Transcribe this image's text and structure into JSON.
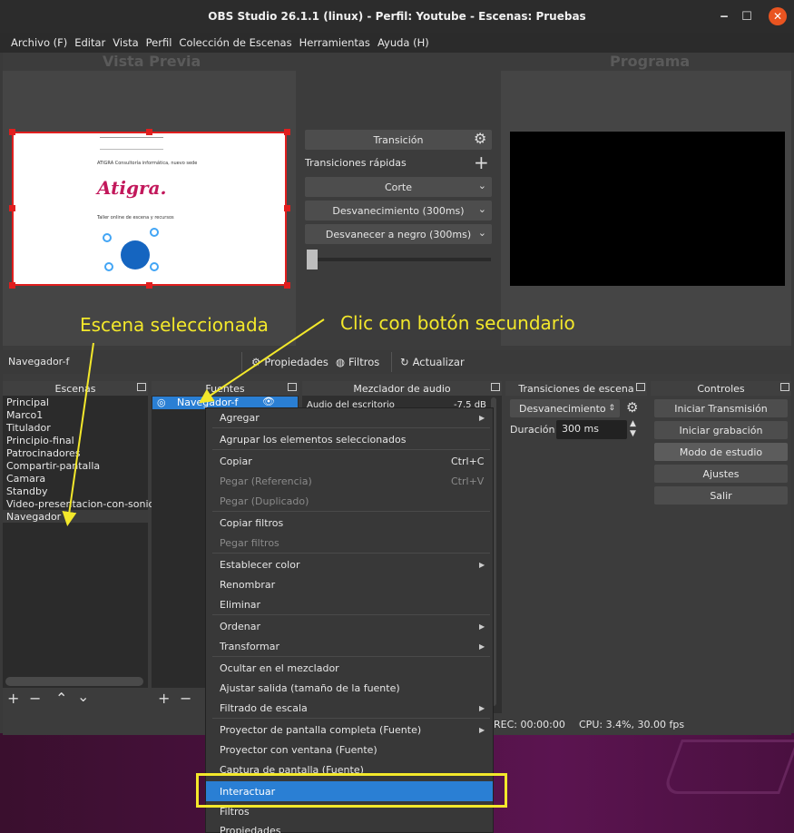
{
  "window": {
    "title": "OBS Studio 26.1.1 (linux) - Perfil: Youtube - Escenas: Pruebas",
    "minimize": "‒",
    "maximize": "☐",
    "close": "✕"
  },
  "menu": [
    "Archivo (F)",
    "Editar",
    "Vista",
    "Perfil",
    "Colección de Escenas",
    "Herramientas",
    "Ayuda (H)"
  ],
  "preview": {
    "title": "Vista Previa",
    "doc_lines": [
      "ATIGRA Consultoría informática, nuevo sede",
      "Atigra.",
      "Taller online de escena y recursos"
    ]
  },
  "program": {
    "title": "Programa"
  },
  "transition": {
    "button": "Transición",
    "quick_label": "Transiciones rápidas",
    "items": [
      "Corte",
      "Desvanecimiento (300ms)",
      "Desvanecer a negro (300ms)"
    ]
  },
  "source_bar": {
    "selected": "Navegador-f",
    "properties": "Propiedades",
    "filters": "Filtros",
    "refresh": "Actualizar"
  },
  "docks": {
    "scenes": "Escenas",
    "sources": "Fuentes",
    "mixer": "Mezclador de audio",
    "transitions": "Transiciones de escena",
    "controls": "Controles"
  },
  "scenes": [
    "Principal",
    "Marco1",
    "Titulador",
    "Principio-final",
    "Patrocinadores",
    "Compartir-pantalla",
    "Camara",
    "Standby",
    "Video-presentacion-con-sonido",
    "Navegador"
  ],
  "sources": [
    "Navegador-f"
  ],
  "mixer": {
    "channel": "Audio del escritorio",
    "level": "-7.5 dB"
  },
  "scene_transitions": {
    "selected": "Desvanecimiento",
    "duration_label": "Duración",
    "duration": "300 ms"
  },
  "controls": [
    "Iniciar Transmisión",
    "Iniciar grabación",
    "Modo de estudio",
    "Ajustes",
    "Salir"
  ],
  "status": {
    "rec": "REC: 00:00:00",
    "cpu": "CPU: 3.4%, 30.00 fps"
  },
  "context_menu": {
    "items": [
      {
        "label": "Agregar",
        "shortcut": "",
        "disabled": false,
        "submenu": true
      },
      {
        "label": "Agrupar los elementos seleccionados",
        "shortcut": "",
        "disabled": false,
        "submenu": false
      },
      {
        "label": "Copiar",
        "shortcut": "Ctrl+C",
        "disabled": false,
        "submenu": false
      },
      {
        "label": "Pegar (Referencia)",
        "shortcut": "Ctrl+V",
        "disabled": true,
        "submenu": false
      },
      {
        "label": "Pegar (Duplicado)",
        "shortcut": "",
        "disabled": true,
        "submenu": false
      },
      {
        "label": "Copiar filtros",
        "shortcut": "",
        "disabled": false,
        "submenu": false
      },
      {
        "label": "Pegar filtros",
        "shortcut": "",
        "disabled": true,
        "submenu": false
      },
      {
        "label": "Establecer color",
        "shortcut": "",
        "disabled": false,
        "submenu": true
      },
      {
        "label": "Renombrar",
        "shortcut": "",
        "disabled": false,
        "submenu": false
      },
      {
        "label": "Eliminar",
        "shortcut": "",
        "disabled": false,
        "submenu": false
      },
      {
        "label": "Ordenar",
        "shortcut": "",
        "disabled": false,
        "submenu": true
      },
      {
        "label": "Transformar",
        "shortcut": "",
        "disabled": false,
        "submenu": true
      },
      {
        "label": "Ocultar en el mezclador",
        "shortcut": "",
        "disabled": false,
        "submenu": false
      },
      {
        "label": "Ajustar salida (tamaño de la fuente)",
        "shortcut": "",
        "disabled": false,
        "submenu": false
      },
      {
        "label": "Filtrado de escala",
        "shortcut": "",
        "disabled": false,
        "submenu": true
      },
      {
        "label": "Proyector de pantalla completa (Fuente)",
        "shortcut": "",
        "disabled": false,
        "submenu": true
      },
      {
        "label": "Proyector con ventana (Fuente)",
        "shortcut": "",
        "disabled": false,
        "submenu": false
      },
      {
        "label": "Captura de pantalla (Fuente)",
        "shortcut": "",
        "disabled": false,
        "submenu": false
      },
      {
        "label": "Interactuar",
        "shortcut": "",
        "disabled": false,
        "submenu": false,
        "highlighted": true
      },
      {
        "label": "Filtros",
        "shortcut": "",
        "disabled": false,
        "submenu": false
      },
      {
        "label": "Propiedades",
        "shortcut": "",
        "disabled": false,
        "submenu": false
      }
    ]
  },
  "annotations": {
    "scene_selected": "Escena seleccionada",
    "right_click": "Clic con botón secundario"
  },
  "colors": {
    "accent_highlight": "#2a7fd4",
    "annotation": "#f3e82b",
    "selection_border": "#e01e1e"
  }
}
